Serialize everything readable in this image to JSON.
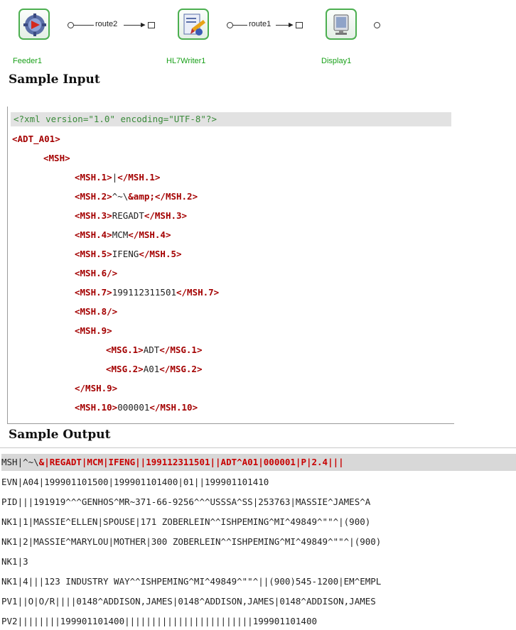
{
  "diagram": {
    "nodes": [
      {
        "label": "Feeder1",
        "icon": "gear-icon"
      },
      {
        "label": "HL7Writer1",
        "icon": "document-writer-icon"
      },
      {
        "label": "Display1",
        "icon": "monitor-icon"
      }
    ],
    "routes": [
      "route2",
      "route1"
    ]
  },
  "input": {
    "title": "Sample Input",
    "pi": "<?xml version=\"1.0\" encoding=\"UTF-8\"?>",
    "lines": [
      {
        "open": "<ADT_A01>"
      },
      {
        "open": "<MSH>"
      },
      {
        "open": "<MSH.1>",
        "text": "|",
        "close": "</MSH.1>"
      },
      {
        "open": "<MSH.2>",
        "text": "^~\\",
        "ent": "&amp;",
        "close": "</MSH.2>"
      },
      {
        "open": "<MSH.3>",
        "text": "REGADT",
        "close": "</MSH.3>"
      },
      {
        "open": "<MSH.4>",
        "text": "MCM",
        "close": "</MSH.4>"
      },
      {
        "open": "<MSH.5>",
        "text": "IFENG",
        "close": "</MSH.5>"
      },
      {
        "open": "<MSH.6/>"
      },
      {
        "open": "<MSH.7>",
        "text": "199112311501",
        "close": "</MSH.7>"
      },
      {
        "open": "<MSH.8/>"
      },
      {
        "open": "<MSH.9>"
      },
      {
        "open": "<MSG.1>",
        "text": "ADT",
        "close": "</MSG.1>"
      },
      {
        "open": "<MSG.2>",
        "text": "A01",
        "close": "</MSG.2>"
      },
      {
        "open": "</MSH.9>"
      },
      {
        "open": "<MSH.10>",
        "text": "000001",
        "close": "</MSH.10>"
      }
    ]
  },
  "output": {
    "title": "Sample Output",
    "first_prefix": "MSH|^~\\",
    "first_highlight": "&|REGADT|MCM|IFENG||199112311501||ADT^A01|000001|P|2.4|||",
    "lines": [
      "EVN|A04|199901101500|199901101400|01||199901101410",
      "PID|||191919^^^GENHOS^MR~371-66-9256^^^USSSA^SS|253763|MASSIE^JAMES^A",
      "NK1|1|MASSIE^ELLEN|SPOUSE|171 ZOBERLEIN^^ISHPEMING^MI^49849^\"\"^|(900)",
      "NK1|2|MASSIE^MARYLOU|MOTHER|300 ZOBERLEIN^^ISHPEMING^MI^49849^\"\"^|(900)",
      "NK1|3",
      "NK1|4|||123 INDUSTRY WAY^^ISHPEMING^MI^49849^\"\"^||(900)545-1200|EM^EMPL",
      "PV1||O|O/R||||0148^ADDISON,JAMES|0148^ADDISON,JAMES|0148^ADDISON,JAMES",
      "PV2||||||||199901101400||||||||||||||||||||||||199901101400"
    ]
  }
}
